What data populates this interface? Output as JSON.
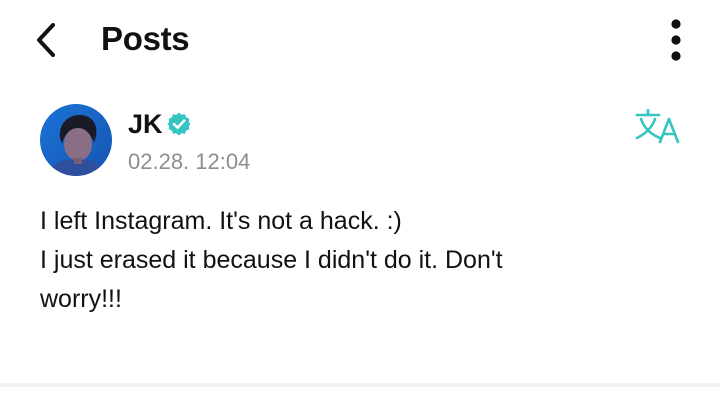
{
  "header": {
    "back_icon": "chevron-left-icon",
    "title": "Posts",
    "more_icon": "more-vertical-icon"
  },
  "post": {
    "author": "JK",
    "verified_icon": "verified-badge-icon",
    "verified_color": "#35c5c0",
    "timestamp": "02.28. 12:04",
    "translate_icon": "translate-icon",
    "translate_color": "#35c5c0",
    "body_lines": [
      "I left Instagram. It's not a hack. :)",
      "I just erased it because I didn't do it. Don't",
      "worry!!!"
    ]
  }
}
